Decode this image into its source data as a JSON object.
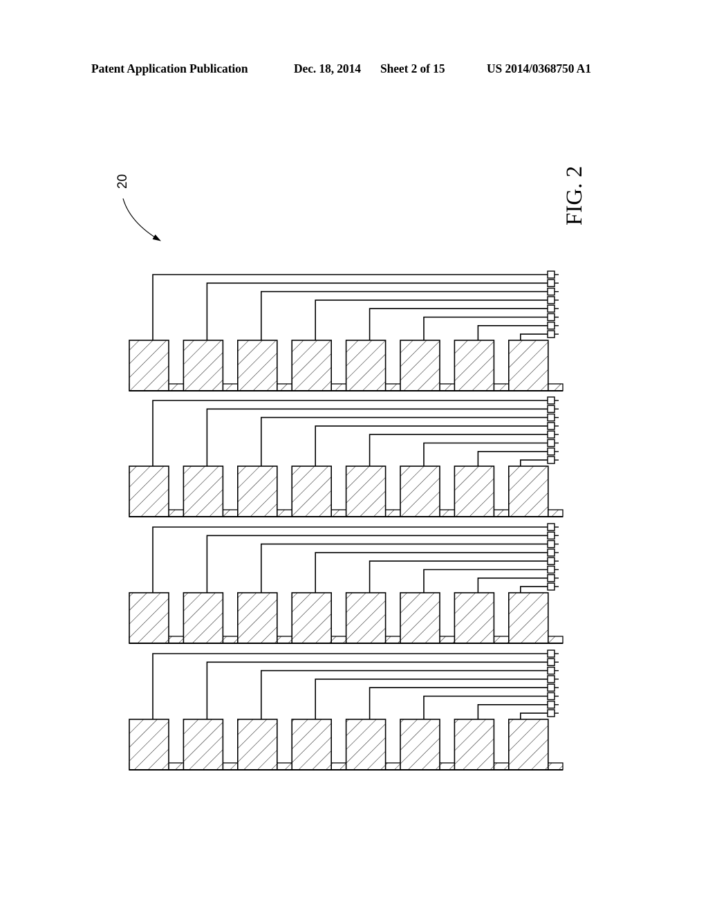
{
  "header": {
    "publication_type": "Patent Application Publication",
    "date": "Dec. 18, 2014",
    "sheet": "Sheet 2 of 15",
    "publication_number": "US 2014/0368750 A1"
  },
  "figure": {
    "label": "FIG. 2",
    "reference_numeral": "20",
    "groups": 4,
    "blocks_per_group": 8,
    "pads_per_group": 8,
    "colors": {
      "stroke": "#000000",
      "hatch": "#222222",
      "background": "#ffffff"
    }
  }
}
